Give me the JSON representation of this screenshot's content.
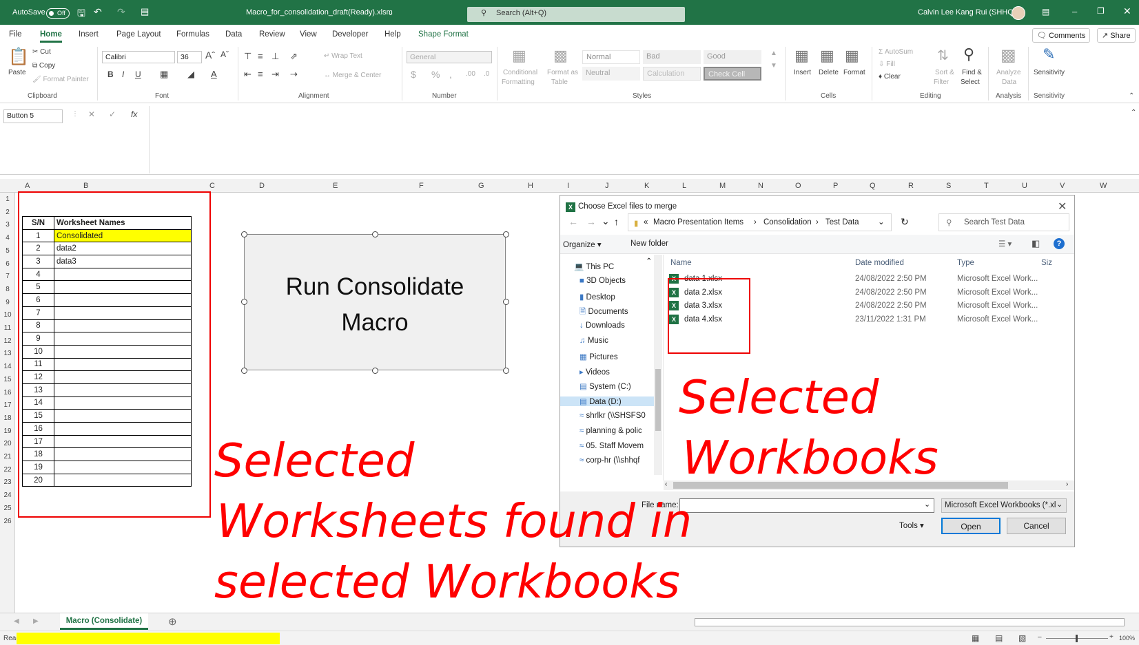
{
  "titlebar": {
    "autosave": "AutoSave",
    "autosave_state": "Off",
    "filename": "Macro_for_consolidation_draft(Ready).xlsm",
    "search": "Search (Alt+Q)",
    "user": "Calvin Lee Kang Rui (SHHQ)"
  },
  "menu": {
    "items": [
      "File",
      "Home",
      "Insert",
      "Page Layout",
      "Formulas",
      "Data",
      "Review",
      "View",
      "Developer",
      "Help",
      "Shape Format"
    ],
    "comments": "Comments",
    "share": "Share"
  },
  "ribbon": {
    "clipboard": {
      "paste": "Paste",
      "cut": "Cut",
      "copy": "Copy",
      "painter": "Format Painter",
      "label": "Clipboard"
    },
    "font": {
      "name": "Calibri",
      "size": "36",
      "label": "Font"
    },
    "alignment": {
      "wrap": "Wrap Text",
      "merge": "Merge & Center",
      "label": "Alignment"
    },
    "number": {
      "format": "General",
      "label": "Number"
    },
    "styles": {
      "cond1": "Conditional",
      "cond2": "Formatting",
      "fmt1": "Format as",
      "fmt2": "Table",
      "normal": "Normal",
      "bad": "Bad",
      "good": "Good",
      "neutral": "Neutral",
      "calculation": "Calculation",
      "checkcell": "Check Cell",
      "label": "Styles"
    },
    "cells": {
      "insert": "Insert",
      "delete": "Delete",
      "format": "Format",
      "label": "Cells"
    },
    "editing": {
      "autosum": "AutoSum",
      "fill": "Fill",
      "clear": "Clear",
      "sort1": "Sort &",
      "sort2": "Filter",
      "find1": "Find &",
      "find2": "Select",
      "label": "Editing"
    },
    "analysis": {
      "analyze1": "Analyze",
      "analyze2": "Data",
      "label": "Analysis"
    },
    "sensitivity": {
      "btn": "Sensitivity",
      "label": "Sensitivity"
    }
  },
  "formula_bar": {
    "namebox": "Button 5",
    "fx": "fx"
  },
  "columns": [
    "A",
    "B",
    "C",
    "D",
    "E",
    "F",
    "G",
    "H",
    "I",
    "J",
    "K",
    "L",
    "M",
    "N",
    "O",
    "P",
    "Q",
    "R",
    "S",
    "T",
    "U",
    "V",
    "W"
  ],
  "rows": [
    "1",
    "2",
    "3",
    "4",
    "5",
    "6",
    "7",
    "8",
    "9",
    "10",
    "11",
    "12",
    "13",
    "14",
    "15",
    "16",
    "17",
    "18",
    "19",
    "20",
    "21",
    "22",
    "23",
    "24",
    "25",
    "26"
  ],
  "worksheet_table": {
    "headers": [
      "S/N",
      "Worksheet Names"
    ],
    "rows": [
      [
        "1",
        "Consolidated"
      ],
      [
        "2",
        "data2"
      ],
      [
        "3",
        "data3"
      ],
      [
        "4",
        ""
      ],
      [
        "5",
        ""
      ],
      [
        "6",
        ""
      ],
      [
        "7",
        ""
      ],
      [
        "8",
        ""
      ],
      [
        "9",
        ""
      ],
      [
        "10",
        ""
      ],
      [
        "11",
        ""
      ],
      [
        "12",
        ""
      ],
      [
        "13",
        ""
      ],
      [
        "14",
        ""
      ],
      [
        "15",
        ""
      ],
      [
        "16",
        ""
      ],
      [
        "17",
        ""
      ],
      [
        "18",
        ""
      ],
      [
        "19",
        ""
      ],
      [
        "20",
        ""
      ]
    ]
  },
  "macro_button": {
    "line1": "Run Consolidate",
    "line2": "Macro"
  },
  "dialog": {
    "title": "Choose Excel files to merge",
    "breadcrumb": [
      "«",
      "Macro Presentation Items",
      "Consolidation",
      "Test Data"
    ],
    "search_placeholder": "Search Test Data",
    "organize": "Organize",
    "new_folder": "New folder",
    "nav": [
      "This PC",
      "3D Objects",
      "Desktop",
      "Documents",
      "Downloads",
      "Music",
      "Pictures",
      "Videos",
      "System (C:)",
      "Data (D:)",
      "shrlkr (\\\\SHSFS0",
      "planning & polic",
      "05. Staff Movem",
      "corp-hr (\\\\shhqf"
    ],
    "columns": [
      "Name",
      "Date modified",
      "Type",
      "Siz"
    ],
    "files": [
      {
        "name": "data 1.xlsx",
        "date": "24/08/2022 2:50 PM",
        "type": "Microsoft Excel Work..."
      },
      {
        "name": "data 2.xlsx",
        "date": "24/08/2022 2:50 PM",
        "type": "Microsoft Excel Work..."
      },
      {
        "name": "data 3.xlsx",
        "date": "24/08/2022 2:50 PM",
        "type": "Microsoft Excel Work..."
      },
      {
        "name": "data 4.xlsx",
        "date": "23/11/2022 1:31 PM",
        "type": "Microsoft Excel Work..."
      }
    ],
    "filename_label": "File name:",
    "filename_value": "",
    "filetype": "Microsoft Excel Workbooks (*.xl",
    "tools": "Tools",
    "open": "Open",
    "cancel": "Cancel"
  },
  "annotations": {
    "workbooks_1": "Selected",
    "workbooks_2": "Workbooks",
    "worksheets_1": "Selected",
    "worksheets_2": "Worksheets found in",
    "worksheets_3": "selected Workbooks"
  },
  "sheet_tab": "Macro (Consolidate)",
  "status": {
    "ready": "Ready",
    "zoom": "100%"
  },
  "colors": {
    "excel_green": "#217346",
    "annotation_red": "#ff0000",
    "highlight_yellow": "#ffff00"
  }
}
